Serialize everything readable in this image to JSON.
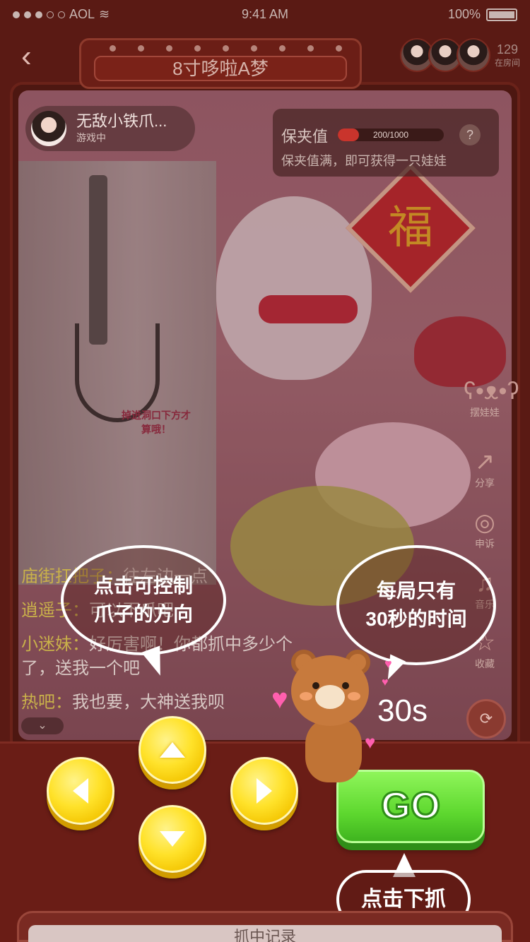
{
  "status_bar": {
    "carrier": "AOL",
    "time": "9:41 AM",
    "battery": "100%"
  },
  "header": {
    "title": "8寸哆啦A梦",
    "viewer_count": "129",
    "viewer_label": "在房间"
  },
  "player": {
    "name": "无敌小铁爪...",
    "status": "游戏中"
  },
  "guarantee": {
    "label": "保夹值",
    "current": 200,
    "max": 1000,
    "value_text": "200/1000",
    "help": "?",
    "tip": "保夹值满，即可获得一只娃娃"
  },
  "machine_sign": "掉进洞口下方才算哦！",
  "side_actions": [
    {
      "label": "摆娃娃",
      "icon": "bear-icon"
    },
    {
      "label": "分享",
      "icon": "share-icon"
    },
    {
      "label": "申诉",
      "icon": "appeal-icon"
    },
    {
      "label": "音乐",
      "icon": "music-icon"
    },
    {
      "label": "收藏",
      "icon": "star-icon"
    }
  ],
  "chat": [
    {
      "user": "庙街扛把子：",
      "message": "往左边一点"
    },
    {
      "user": "逍遥子：",
      "message": "可以下爪吧"
    },
    {
      "user": "小迷妹：",
      "message": "好厉害啊！你都抓中多少个了，送我一个吧"
    },
    {
      "user": "热吧：",
      "message": "我也要，大神送我呗"
    }
  ],
  "chat_toggle": "⌄",
  "tutorial": {
    "direction_hint": [
      "点击可控制",
      "爪子的方向"
    ],
    "time_hint": [
      "每局只有",
      "30秒的时间"
    ],
    "grab_hint": "点击下抓"
  },
  "timer": "30s",
  "go_label": "GO",
  "record_tab": "抓中记录",
  "colors": {
    "accent_red": "#6a1d16",
    "go_green": "#5ed82f",
    "dpad_yellow": "#ffe22a"
  }
}
